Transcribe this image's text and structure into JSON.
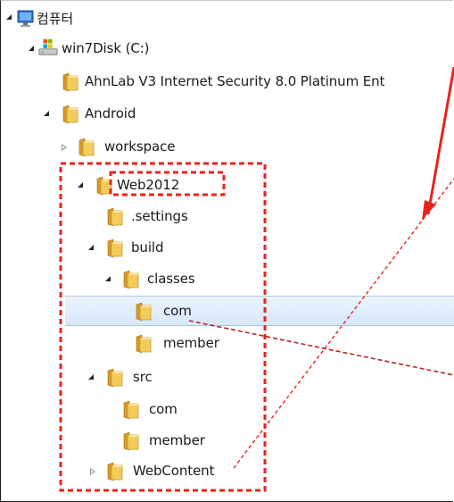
{
  "tree": {
    "computer": "컴퓨터",
    "drive": "win7Disk (C:)",
    "ahnlab": "AhnLab V3 Internet Security 8.0 Platinum Ent",
    "android": "Android",
    "workspace": "workspace",
    "web2012": "Web2012",
    "settings": ".settings",
    "build": "build",
    "classes": "classes",
    "com1": "com",
    "member1": "member",
    "src": "src",
    "com2": "com",
    "member2": "member",
    "webcontent": "WebContent"
  },
  "colors": {
    "annotation": "#e8231d",
    "selection": "#d7e8fb",
    "folder": "#f0c64f"
  },
  "icons": {
    "computer": "computer-icon",
    "drive": "windows-drive-icon",
    "folder": "folder-icon"
  }
}
